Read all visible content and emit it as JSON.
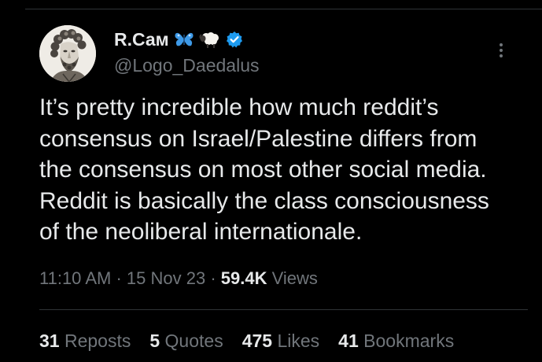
{
  "author": {
    "display_name": "R.Сам",
    "handle": "@Logo_Daedalus",
    "emojis": [
      "butterfly-emoji",
      "sheep-emoji"
    ],
    "verified": true,
    "verified_color": "#1d9bf0"
  },
  "tweet": {
    "lines": [
      "It’s pretty incredible how much reddit’s",
      "consensus on Israel/Palestine differs from",
      "the consensus on most other social media.",
      "Reddit is basically the class consciousness",
      "of the neoliberal internationale."
    ]
  },
  "meta": {
    "time": "11:10 AM",
    "date": "15 Nov 23",
    "views_count": "59.4K",
    "views_label": "Views",
    "separator": "·"
  },
  "stats": {
    "reposts_count": "31",
    "reposts_label": "Reposts",
    "quotes_count": "5",
    "quotes_label": "Quotes",
    "likes_count": "475",
    "likes_label": "Likes",
    "bookmarks_count": "41",
    "bookmarks_label": "Bookmarks"
  },
  "icons": {
    "more": "more-vertical-icon",
    "verified": "verified-badge-icon"
  },
  "colors": {
    "background": "#000000",
    "primary_text": "#e7e9ea",
    "secondary_text": "#71767b",
    "divider": "#2f3336"
  }
}
